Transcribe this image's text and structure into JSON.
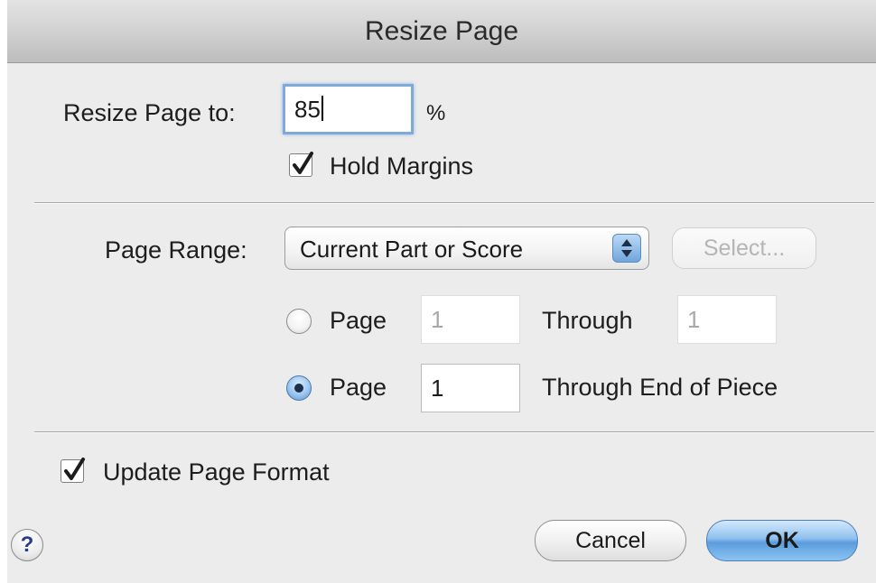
{
  "dialog": {
    "title": "Resize Page"
  },
  "resize": {
    "label": "Resize Page to:",
    "value": "85",
    "unit": "%",
    "hold_margins_label": "Hold Margins",
    "hold_margins_checked": true
  },
  "page_range": {
    "label": "Page Range:",
    "selected": "Current Part or Score",
    "select_button": "Select..."
  },
  "range_option_1": {
    "radio_label": "Page",
    "from_value": "1",
    "through_label": "Through",
    "through_value": "1",
    "selected": false
  },
  "range_option_2": {
    "radio_label": "Page",
    "from_value": "1",
    "through_label": "Through End of Piece",
    "selected": true
  },
  "update_format": {
    "label": "Update Page Format",
    "checked": true
  },
  "buttons": {
    "help": "?",
    "cancel": "Cancel",
    "ok": "OK"
  },
  "colors": {
    "accent": "#6fa6dd",
    "background": "#ececec"
  }
}
